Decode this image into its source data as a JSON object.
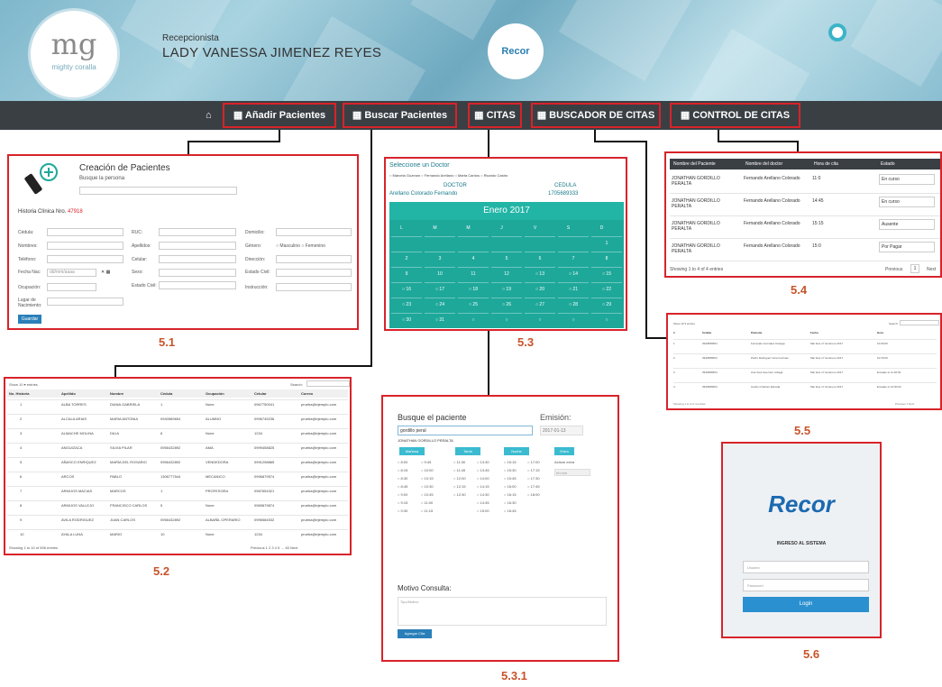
{
  "header": {
    "logo_text": "mg",
    "logo_sub": "mighty coralla",
    "role": "Recepcionista",
    "user_name": "LADY VANESSA JIMENEZ REYES",
    "recor_logo": "Recor"
  },
  "nav": {
    "items": [
      {
        "label": "▦ Añadir Pacientes"
      },
      {
        "label": "▦ Buscar Pacientes"
      },
      {
        "label": "▦ CITAS"
      },
      {
        "label": "▦ BUSCADOR DE CITAS"
      },
      {
        "label": "▦ CONTROL DE CITAS"
      }
    ]
  },
  "figure_labels": {
    "f51": "5.1",
    "f52": "5.2",
    "f53": "5.3",
    "f531": "5.3.1",
    "f54": "5.4",
    "f55": "5.5",
    "f56": "5.6"
  },
  "creacion": {
    "title": "Creación de Pacientes",
    "search_label": "Busque la persona",
    "historia_label": "Historia Clínica Nro.",
    "historia_num": "47918",
    "left_labels": [
      "Cédula:",
      "Nombres:",
      "Teléfono:",
      "Fecha Nac:",
      "Ocupación:",
      "Lugar de Nacimiento:"
    ],
    "mid_labels": [
      "RUC:",
      "Apellidos:",
      "Celular:",
      "Sexo:",
      "Estado Civil:"
    ],
    "right_labels": [
      "Domicilio:",
      "Género:",
      "Dirección:",
      "Estado Civil:",
      "Instrucción:"
    ],
    "genero_opts": "○ Masculino ○ Femenino",
    "date_placeholder": "dd/mm/aaaa",
    "save_btn": "Guardar"
  },
  "citas": {
    "title": "Seleccione un Doctor",
    "radios": "○ Marcela Guzman  ○ Fernando Arellano  ○ Marta Cantos  ○ Ricardo Castro",
    "doctor_hdr": "DOCTOR",
    "cedula_hdr": "CEDULA",
    "doctor_name": "Arellano Colorado Fernando",
    "doctor_cedula": "1705689333",
    "month": "Enero 2017",
    "weekdays": [
      "L",
      "M",
      "M",
      "J",
      "V",
      "S",
      "D"
    ],
    "rows": [
      [
        "",
        "",
        "",
        "",
        "",
        "",
        "1"
      ],
      [
        "2",
        "3",
        "4",
        "5",
        "6",
        "7",
        "8"
      ],
      [
        "9",
        "10",
        "11",
        "12",
        "○ 13",
        "○ 14",
        "○ 15"
      ],
      [
        "○ 16",
        "○ 17",
        "○ 18",
        "○ 19",
        "○ 20",
        "○ 21",
        "○ 22"
      ],
      [
        "○ 23",
        "○ 24",
        "○ 25",
        "○ 26",
        "○ 27",
        "○ 28",
        "○ 29"
      ],
      [
        "○ 30",
        "○ 31",
        "○",
        "○",
        "○",
        "○",
        "○"
      ]
    ]
  },
  "control": {
    "headers": [
      "Nombre del Paciente",
      "Nombre del doctor",
      "Hora de cita",
      "Estado"
    ],
    "rows": [
      {
        "p": "JONATHAN GORDILLO PERALTA",
        "d": "Fernando Arellano Colorado",
        "h": "11:0",
        "e": "En curso"
      },
      {
        "p": "JONATHAN GORDILLO PERALTA",
        "d": "Fernando Arellano Colorado",
        "h": "14:45",
        "e": "En curso"
      },
      {
        "p": "JONATHAN GORDILLO PERALTA",
        "d": "Fernando Arellano Colorado",
        "h": "15:15",
        "e": "Ausente"
      },
      {
        "p": "JONATHAN GORDILLO PERALTA",
        "d": "Fernando Arellano Colorado",
        "h": "15:0",
        "e": "Por Pagar"
      }
    ],
    "footer": "Showing 1 to 4 of 4 entries",
    "prev": "Previous",
    "page": "1",
    "next": "Next"
  },
  "buscador": {
    "show": "Show 10 ▾ entries",
    "search": "Search:",
    "headers": [
      "#",
      "Cédula",
      "Paciente",
      "Fecha",
      "Hora"
    ],
    "rows": [
      [
        "1",
        "0940589654",
        "Fernando Gonzalez Arteaga",
        "Mar Ene 17 de Enero 2017",
        "10:00:00"
      ],
      [
        "2",
        "0940589654",
        "Pedro Rodríguez Vera Guzman",
        "Mar Ene 17 de Enero 2017",
        "10:15:00"
      ],
      [
        "3",
        "0940589654",
        "Ana Vera Guerrero Artiaga",
        "Mar Ene 17 de Enero 2017",
        "Enviado el 11:30:00"
      ],
      [
        "4",
        "0940589654",
        "Carlos Ordoñez Estrada",
        "Mar Ene 17 de Enero 2017",
        "Enviado el 12:00:00"
      ]
    ],
    "footer": "Showing 1 to 4 of 4 entries",
    "pager": "Previous 1 Next"
  },
  "buscar": {
    "show": "Show 10 ▾ entries",
    "search": "Search:",
    "headers": [
      "No. Historia",
      "Apellido",
      "Nombre",
      "Cédula",
      "Ocupación",
      "Celular",
      "Correo"
    ],
    "rows": [
      [
        "1",
        "ALBA TORRES",
        "DIANA GABRIELA",
        "1",
        "None",
        "0967750041",
        "prueba@ejemplo.com"
      ],
      [
        "2",
        "ALCALA ARIAS",
        "MARIA ANTONIA",
        "0940589654",
        "ALUMNO",
        "0996745236",
        "prueba@ejemplo.com"
      ],
      [
        "3",
        "ALMACHE MOLINA",
        "DILIA",
        "6",
        "None",
        "1234",
        "prueba@ejemplo.com"
      ],
      [
        "4",
        "ANGUIZACA",
        "SILVIA PILAR",
        "0956432892",
        "AMA",
        "0999458825",
        "prueba@ejemplo.com"
      ],
      [
        "5",
        "AÑASCO ENRIQUEZ",
        "MARÍA DEL ROSARIO",
        "0956432892",
        "VENDEDORA",
        "0991298865",
        "prueba@ejemplo.com"
      ],
      [
        "6",
        "ARCOS",
        "PABLO",
        "1306777544",
        "MECANICO",
        "0996879574",
        "prueba@ejemplo.com"
      ],
      [
        "7",
        "ARMIJOS MACIAS",
        "MARCOS",
        "1",
        "PROFESORA",
        "0987654321",
        "prueba@ejemplo.com"
      ],
      [
        "8",
        "ARMIJOS VALLEJO",
        "FRANCISCO CARLOS",
        "5",
        "None",
        "0965879874",
        "prueba@ejemplo.com"
      ],
      [
        "9",
        "AVILA RODRIGUEZ",
        "JUAN CARLOS",
        "0956432892",
        "ALBAÑIL OPERARIO",
        "0996584532",
        "prueba@ejemplo.com"
      ],
      [
        "10",
        "AYALA LUNA",
        "MARIO",
        "10",
        "None",
        "1234",
        "prueba@ejemplo.com"
      ]
    ],
    "footer": "Showing 1 to 10 of 596 entries",
    "pager": "Previous 1 2 3 4 5 … 60 Next"
  },
  "agendar": {
    "title": "Busque el paciente",
    "search_value": "gordillo peral",
    "suggestion": "JONATHAN GORDILLO PERALTA",
    "emision_label": "Emisión:",
    "emision_value": "2017-01-13",
    "col_labels": [
      "Mañana",
      "Tarde",
      "Noche"
    ],
    "extra_label": "Extra",
    "activar_extra": "Activar extra",
    "extra_field": "hh:mm",
    "times": [
      [
        "○ 8:00",
        "○ 9:45",
        "○ 11:30",
        "○ 13:30",
        "○ 15:15",
        "○ 17:00"
      ],
      [
        "○ 8:15",
        "○ 10:00",
        "○ 11:45",
        "○ 13:45",
        "○ 15:30",
        "○ 17:15"
      ],
      [
        "○ 8:30",
        "○ 10:15",
        "○ 12:00",
        "○ 14:00",
        "○ 15:45",
        "○ 17:30"
      ],
      [
        "○ 8:45",
        "○ 10:30",
        "○ 12:15",
        "○ 14:15",
        "○ 16:00",
        "○ 17:45"
      ],
      [
        "○ 9:00",
        "○ 10:45",
        "○ 12:30",
        "○ 14:30",
        "○ 16:15",
        "○ 18:00"
      ],
      [
        "○ 9:15",
        "○ 11:00",
        "",
        "○ 14:45",
        "○ 16:30",
        ""
      ],
      [
        "○ 9:30",
        "○ 11:15",
        "",
        "○ 15:00",
        "○ 16:45",
        ""
      ]
    ],
    "motivo_label": "Motivo Consulta:",
    "motivo_placeholder": "Tipo/Motivo",
    "submit": "Agregar Cita"
  },
  "login": {
    "logo": "Recor",
    "heading": "INGRESO AL SISTEMA",
    "user_placeholder": "Usuario",
    "pass_placeholder": "Password",
    "btn": "Login"
  },
  "colors": {
    "accent": "#d8232a",
    "teal": "#1ea89a",
    "navbar": "#3a3f44",
    "label": "#c8532a"
  }
}
